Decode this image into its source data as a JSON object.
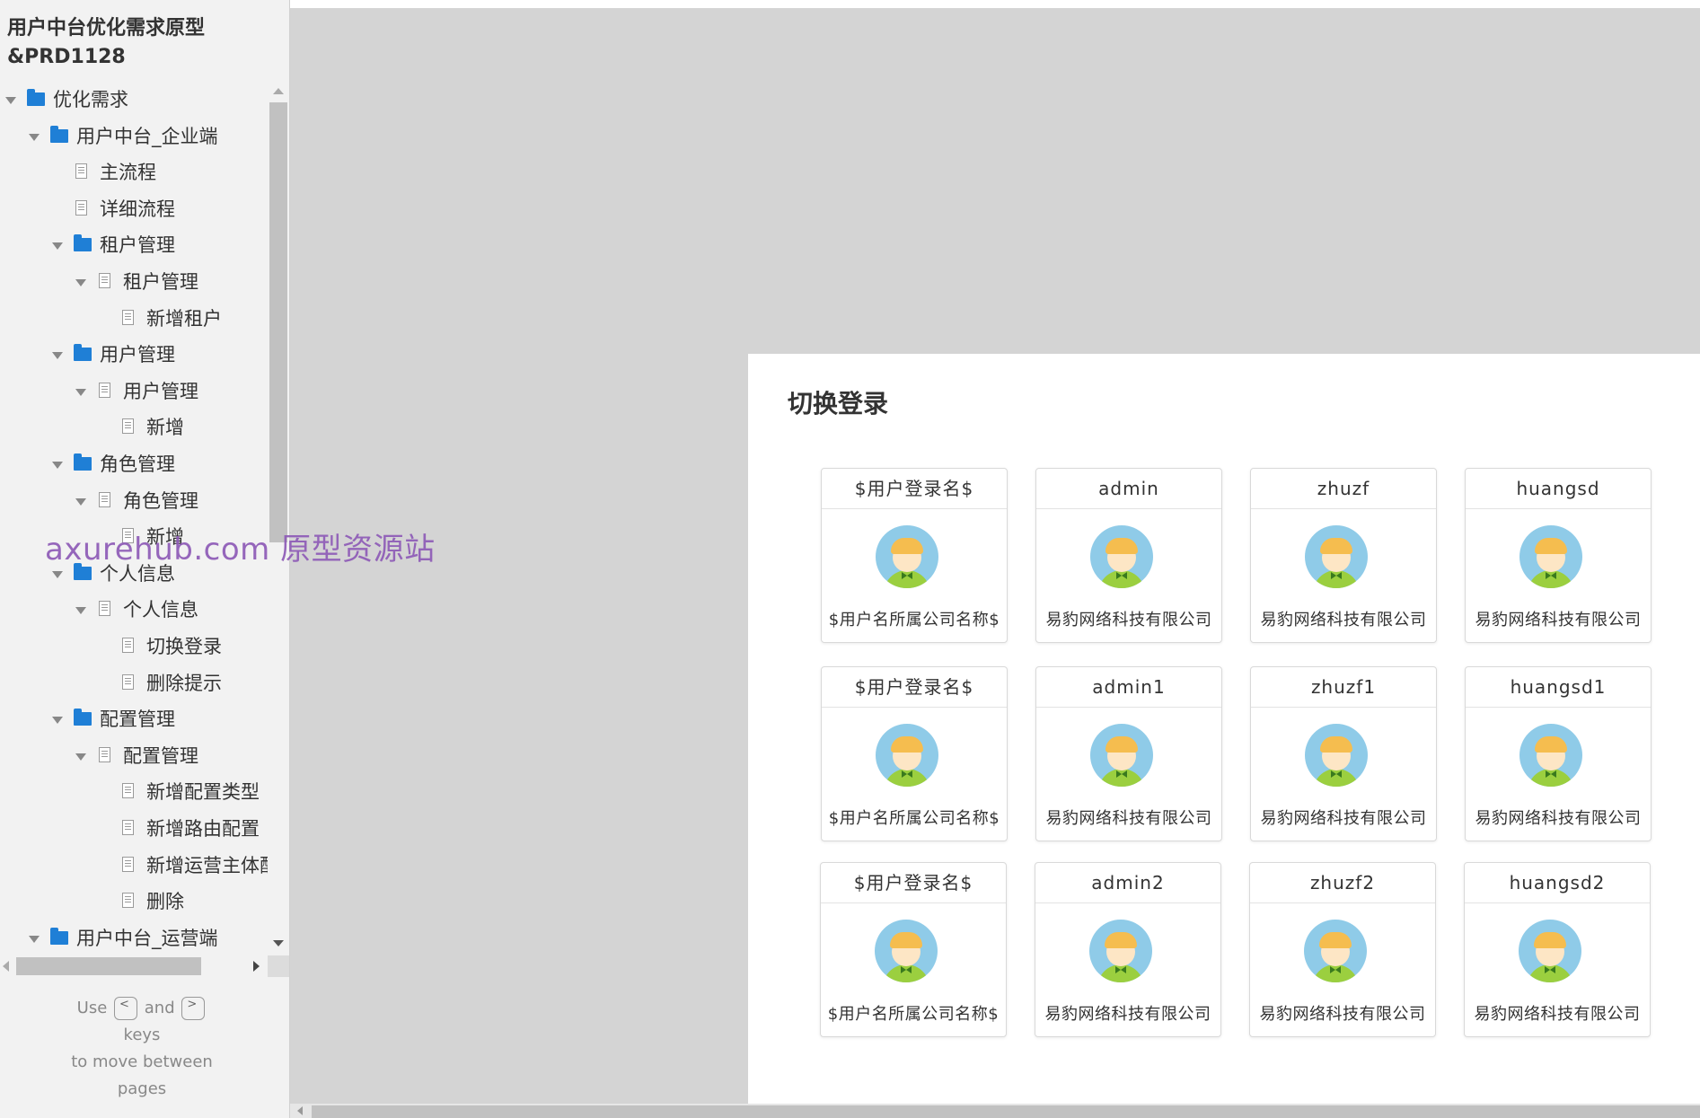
{
  "sidebar": {
    "project_title_line1": "用户中台优化需求原型",
    "project_title_line2": "&PRD1128",
    "tree": [
      {
        "label": "优化需求",
        "type": "folder",
        "expanded": true,
        "level": 0
      },
      {
        "label": "用户中台_企业端",
        "type": "folder",
        "expanded": true,
        "level": 1
      },
      {
        "label": "主流程",
        "type": "page",
        "level": 2
      },
      {
        "label": "详细流程",
        "type": "page",
        "level": 2
      },
      {
        "label": "租户管理",
        "type": "folder",
        "expanded": true,
        "level": 2
      },
      {
        "label": "租户管理",
        "type": "page",
        "expanded": true,
        "level": 3
      },
      {
        "label": "新增租户",
        "type": "page",
        "level": 4
      },
      {
        "label": "用户管理",
        "type": "folder",
        "expanded": true,
        "level": 2
      },
      {
        "label": "用户管理",
        "type": "page",
        "expanded": true,
        "level": 3
      },
      {
        "label": "新增",
        "type": "page",
        "level": 4
      },
      {
        "label": "角色管理",
        "type": "folder",
        "expanded": true,
        "level": 2
      },
      {
        "label": "角色管理",
        "type": "page",
        "expanded": true,
        "level": 3
      },
      {
        "label": "新增",
        "type": "page",
        "level": 4
      },
      {
        "label": "个人信息",
        "type": "folder",
        "expanded": true,
        "level": 2
      },
      {
        "label": "个人信息",
        "type": "page",
        "expanded": true,
        "level": 3
      },
      {
        "label": "切换登录",
        "type": "page",
        "level": 4
      },
      {
        "label": "删除提示",
        "type": "page",
        "level": 4
      },
      {
        "label": "配置管理",
        "type": "folder",
        "expanded": true,
        "level": 2
      },
      {
        "label": "配置管理",
        "type": "page",
        "expanded": true,
        "level": 3
      },
      {
        "label": "新增配置类型",
        "type": "page",
        "level": 4
      },
      {
        "label": "新增路由配置",
        "type": "page",
        "level": 4
      },
      {
        "label": "新增运营主体配置",
        "type": "page",
        "level": 4
      },
      {
        "label": "删除",
        "type": "page",
        "level": 4
      },
      {
        "label": "用户中台_运营端",
        "type": "folder",
        "expanded": true,
        "level": 1
      }
    ],
    "nav_hint": {
      "use": "Use",
      "prev_key": "<",
      "and": "and",
      "next_key": ">",
      "keys": "keys",
      "line3": "to move between",
      "line4": "pages"
    },
    "watermark": "axurehub.com 原型资源站"
  },
  "panel": {
    "title": "切换登录",
    "cards": [
      {
        "username": "$用户登录名$",
        "company": "$用户名所属公司名称$"
      },
      {
        "username": "admin",
        "company": "易豹网络科技有限公司"
      },
      {
        "username": "zhuzf",
        "company": "易豹网络科技有限公司"
      },
      {
        "username": "huangsd",
        "company": "易豹网络科技有限公司"
      },
      {
        "username": "$用户登录名$",
        "company": "$用户名所属公司名称$"
      },
      {
        "username": "admin1",
        "company": "易豹网络科技有限公司"
      },
      {
        "username": "zhuzf1",
        "company": "易豹网络科技有限公司"
      },
      {
        "username": "huangsd1",
        "company": "易豹网络科技有限公司"
      },
      {
        "username": "$用户登录名$",
        "company": "$用户名所属公司名称$"
      },
      {
        "username": "admin2",
        "company": "易豹网络科技有限公司"
      },
      {
        "username": "zhuzf2",
        "company": "易豹网络科技有限公司"
      },
      {
        "username": "huangsd2",
        "company": "易豹网络科技有限公司"
      }
    ]
  },
  "colors": {
    "folder_icon": "#1f7fd6",
    "watermark": "#8e5bb7",
    "canvas_bg": "#d4d4d4"
  }
}
